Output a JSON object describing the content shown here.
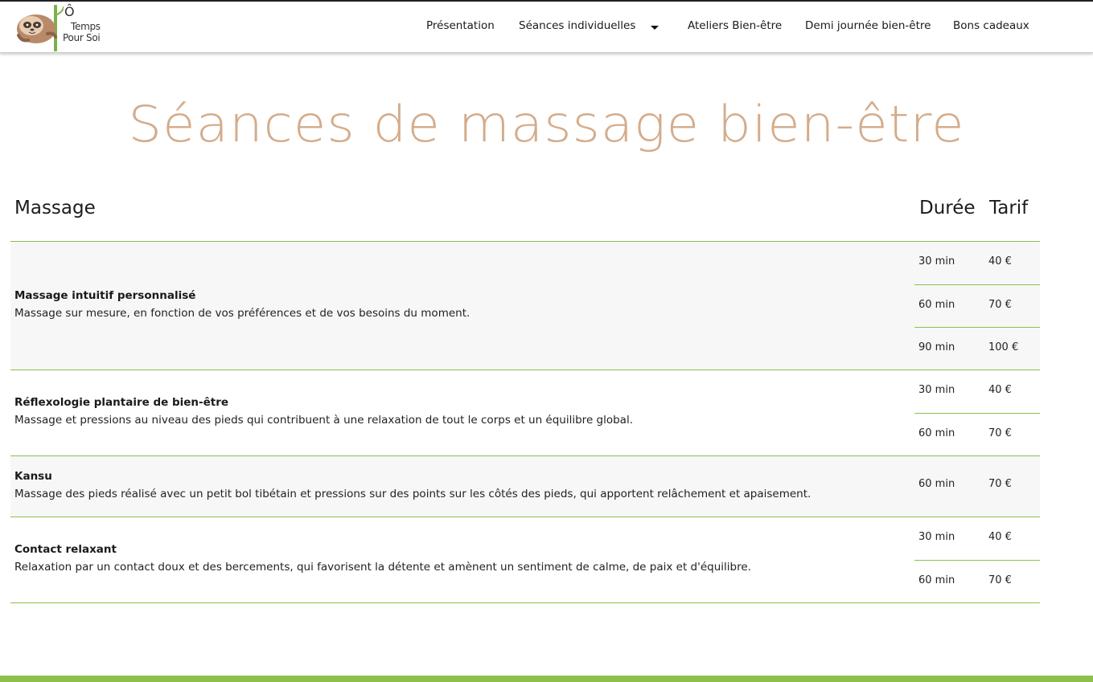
{
  "brand": {
    "line1": "Ô",
    "line2": "Temps",
    "line3": "Pour Soi"
  },
  "nav": {
    "items": [
      {
        "label": "Présentation"
      },
      {
        "label": "Séances individuelles"
      },
      {
        "label": "Ateliers Bien-être"
      },
      {
        "label": "Demi journée bien-être"
      },
      {
        "label": "Bons cadeaux"
      }
    ]
  },
  "page": {
    "title": "Séances de massage bien-être"
  },
  "table": {
    "headers": {
      "massage": "Massage",
      "duree": "Durée",
      "tarif": "Tarif"
    },
    "rows": [
      {
        "name": "Massage intuitif personnalisé",
        "description": "Massage sur mesure, en fonction de vos préférences et de vos besoins du moment.",
        "prices": [
          {
            "duree": "30 min",
            "tarif": "40 €"
          },
          {
            "duree": "60 min",
            "tarif": "70 €"
          },
          {
            "duree": "90 min",
            "tarif": "100 €"
          }
        ]
      },
      {
        "name": "Réflexologie plantaire de bien-être",
        "description": "Massage et pressions au niveau des pieds qui contribuent à une relaxation de tout le corps et un équilibre global.",
        "prices": [
          {
            "duree": "30 min",
            "tarif": "40 €"
          },
          {
            "duree": "60 min",
            "tarif": "70 €"
          }
        ]
      },
      {
        "name": "Kansu",
        "description": "Massage des pieds réalisé avec un petit bol tibétain et pressions sur des points sur les côtés des pieds, qui apportent relâchement et apaisement.",
        "prices": [
          {
            "duree": "60 min",
            "tarif": "70 €"
          }
        ]
      },
      {
        "name": "Contact relaxant",
        "description": "Relaxation par un contact doux et des bercements, qui favorisent la détente et amènent un sentiment de calme, de paix et d'équilibre.",
        "prices": [
          {
            "duree": "30 min",
            "tarif": "40 €"
          },
          {
            "duree": "60 min",
            "tarif": "70 €"
          }
        ]
      }
    ]
  },
  "colors": {
    "accent_green": "#8cc04a",
    "title_tan": "#d4ac8b"
  }
}
